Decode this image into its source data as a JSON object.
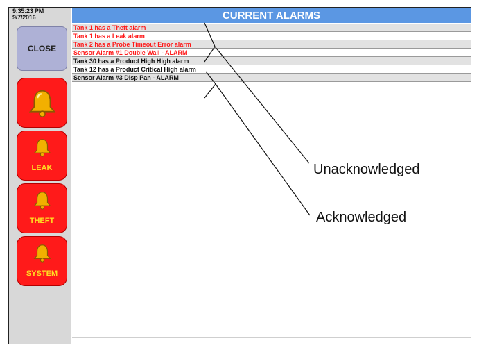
{
  "sidebar": {
    "time": "9:35:23 PM",
    "date": "9/7/2016",
    "close_label": "CLOSE",
    "buttons": [
      {
        "name": "alarm",
        "label": ""
      },
      {
        "name": "leak",
        "label": "LEAK"
      },
      {
        "name": "theft",
        "label": "THEFT"
      },
      {
        "name": "system",
        "label": "SYSTEM"
      }
    ]
  },
  "header": {
    "title": "CURRENT ALARMS"
  },
  "alarms": [
    {
      "text": "Tank 1 has a Theft alarm",
      "status": "unacknowledged"
    },
    {
      "text": "Tank 1 has a Leak alarm",
      "status": "unacknowledged"
    },
    {
      "text": "Tank 2 has a Probe Timeout Error alarm",
      "status": "unacknowledged"
    },
    {
      "text": "Sensor Alarm #1 Double Wall - ALARM",
      "status": "unacknowledged"
    },
    {
      "text": "Tank 30 has a Product High High alarm",
      "status": "acknowledged"
    },
    {
      "text": "Tank 12 has a Product Critical High alarm",
      "status": "acknowledged"
    },
    {
      "text": "Sensor Alarm #3 Disp Pan - ALARM",
      "status": "acknowledged"
    }
  ],
  "callouts": {
    "unacknowledged": "Unacknowledged",
    "acknowledged": "Acknowledged"
  },
  "colors": {
    "header": "#5b97e3",
    "unacknowledged_text": "#ff1a1a",
    "acknowledged_text": "#111111",
    "button_red": "#ff1a1a",
    "bell_gold": "#f2b000",
    "close_button": "#aeb1d6"
  }
}
